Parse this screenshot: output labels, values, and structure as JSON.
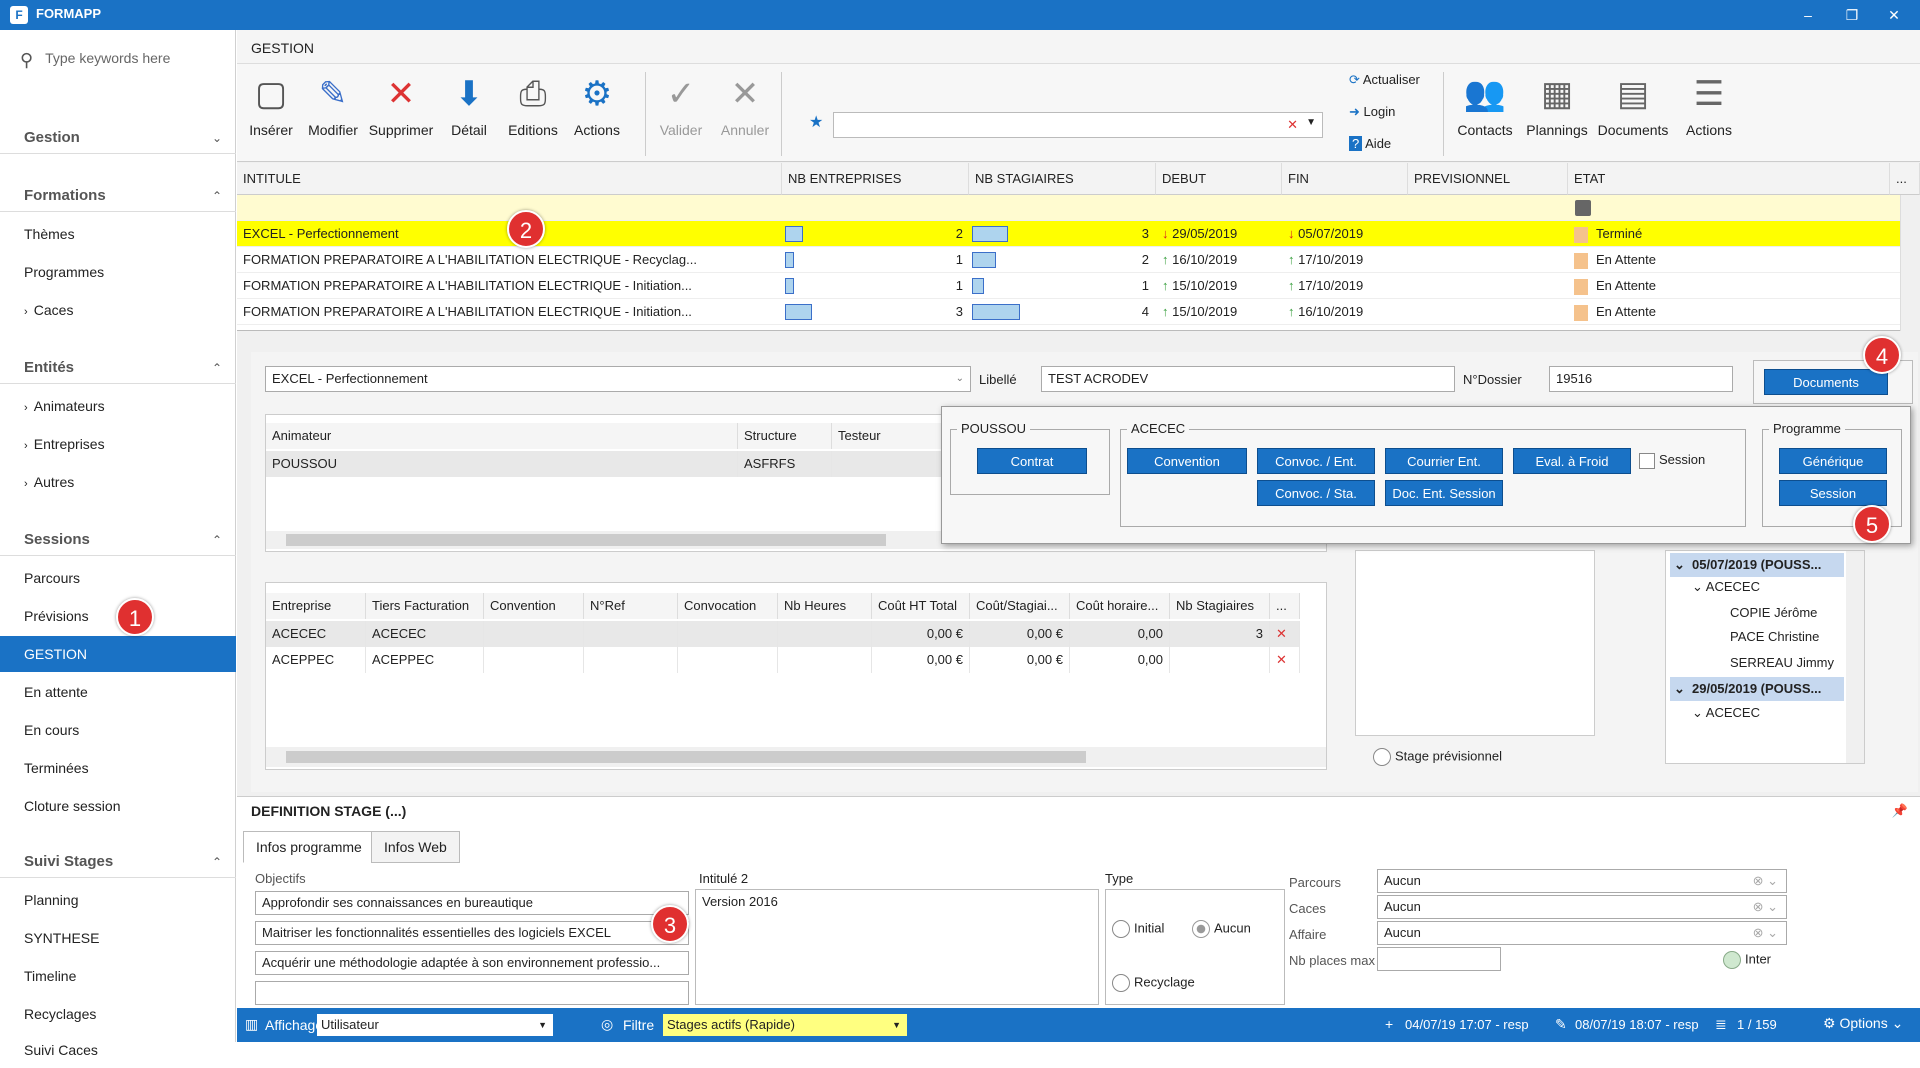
{
  "app": {
    "title": "FORMAPP",
    "win_min": "–",
    "win_restore": "❐",
    "win_close": "✕"
  },
  "sidebar": {
    "search_placeholder": "Type keywords here",
    "groups": [
      {
        "label": "Gestion"
      },
      {
        "label": "Formations"
      },
      {
        "label": "Entités"
      },
      {
        "label": "Sessions"
      },
      {
        "label": "Suivi Stages"
      }
    ],
    "formations": [
      "Thèmes",
      "Programmes",
      "Caces"
    ],
    "entites": [
      "Animateurs",
      "Entreprises",
      "Autres"
    ],
    "sessions": [
      "Parcours",
      "Prévisions",
      "GESTION",
      "En attente",
      "En cours",
      "Terminées",
      "Cloture session"
    ],
    "suivi": [
      "Planning",
      "SYNTHESE",
      "Timeline",
      "Recyclages",
      "Suivi Caces"
    ]
  },
  "ribbon": {
    "title": "GESTION",
    "buttons": [
      "Insérer",
      "Modifier",
      "Supprimer",
      "Détail",
      "Editions",
      "Actions",
      "Valider",
      "Annuler"
    ],
    "small": [
      "Actualiser",
      "Login",
      "Aide"
    ],
    "right": [
      "Contacts",
      "Plannings",
      "Documents",
      "Actions"
    ]
  },
  "grid": {
    "headers": [
      "INTITULE",
      "NB ENTREPRISES",
      "NB STAGIAIRES",
      "DEBUT",
      "FIN",
      "PREVISIONNEL",
      "ETAT"
    ],
    "more": "...",
    "rows": [
      {
        "intitule": "EXCEL - Perfectionnement",
        "ent": "2",
        "stag": "3",
        "debut": "29/05/2019",
        "fin": "05/07/2019",
        "etat": "Terminé",
        "ent_frac": 0.5,
        "stag_frac": 0.75,
        "dir": "down"
      },
      {
        "intitule": "FORMATION PREPARATOIRE A L'HABILITATION ELECTRIQUE - Recyclag...",
        "ent": "1",
        "stag": "2",
        "debut": "16/10/2019",
        "fin": "17/10/2019",
        "etat": "En Attente",
        "ent_frac": 0.25,
        "stag_frac": 0.5,
        "dir": "up"
      },
      {
        "intitule": "FORMATION PREPARATOIRE A L'HABILITATION ELECTRIQUE - Initiation...",
        "ent": "1",
        "stag": "1",
        "debut": "15/10/2019",
        "fin": "17/10/2019",
        "etat": "En Attente",
        "ent_frac": 0.25,
        "stag_frac": 0.25,
        "dir": "up"
      },
      {
        "intitule": "FORMATION PREPARATOIRE A L'HABILITATION ELECTRIQUE - Initiation...",
        "ent": "3",
        "stag": "4",
        "debut": "15/10/2019",
        "fin": "16/10/2019",
        "etat": "En Attente",
        "ent_frac": 0.75,
        "stag_frac": 1.0,
        "dir": "up"
      }
    ]
  },
  "detail": {
    "programme": "EXCEL - Perfectionnement",
    "libelle_label": "Libellé",
    "libelle": "TEST ACRODEV",
    "dossier_label": "N°Dossier",
    "dossier": "19516",
    "documents_btn": "Documents"
  },
  "animateurs": {
    "headers": [
      "Animateur",
      "Structure",
      "Testeur"
    ],
    "rows": [
      [
        "POUSSOU",
        "ASFRFS",
        ""
      ]
    ]
  },
  "entreprises": {
    "headers": [
      "Entreprise",
      "Tiers Facturation",
      "Convention",
      "N°Ref",
      "Convocation",
      "Nb Heures",
      "Coût HT Total",
      "Coût/Stagiai...",
      "Coût horaire...",
      "Nb Stagiaires",
      "..."
    ],
    "rows": [
      [
        "ACECEC",
        "ACECEC",
        "",
        "",
        "",
        "",
        "0,00 €",
        "0,00 €",
        "0,00",
        "3"
      ],
      [
        "ACEPPEC",
        "ACEPPEC",
        "",
        "",
        "",
        "",
        "0,00 €",
        "0,00 €",
        "0,00",
        ""
      ]
    ]
  },
  "docpopup": {
    "g1": "POUSSOU",
    "contrat": "Contrat",
    "g2": "ACECEC",
    "b2": [
      "Convention",
      "Convoc. / Ent.",
      "Courrier Ent.",
      "Eval. à Froid",
      "Convoc. / Sta.",
      "Doc. Ent. Session"
    ],
    "session_chk": "Session",
    "g3": "Programme",
    "generique": "Générique",
    "session": "Session"
  },
  "tree": {
    "items": [
      "05/07/2019 (POUSS...",
      "ACECEC",
      "COPIE Jérôme",
      "PACE Christine",
      "SERREAU Jimmy",
      "29/05/2019 (POUSS...",
      "ACECEC"
    ]
  },
  "stage_previsionnel": "Stage prévisionnel",
  "definition": {
    "title": "DEFINITION STAGE (...)",
    "tabs": [
      "Infos programme",
      "Infos Web"
    ],
    "objectifs_label": "Objectifs",
    "objectifs": [
      "Approfondir ses connaissances en bureautique",
      "Maitriser les fonctionnalités essentielles des logiciels EXCEL",
      "Acquérir une méthodologie adaptée à son environnement professio..."
    ],
    "intitule2_label": "Intitulé 2",
    "intitule2": "Version 2016",
    "type_label": "Type",
    "types": [
      "Initial",
      "Aucun",
      "Recyclage"
    ],
    "parcours_label": "Parcours",
    "parcours": "Aucun",
    "caces_label": "Caces",
    "caces": "Aucun",
    "affaire_label": "Affaire",
    "affaire": "Aucun",
    "places_label": "Nb places max",
    "inter": "Inter"
  },
  "status": {
    "affichage_label": "Affichage",
    "affichage": "Utilisateur",
    "filtre_label": "Filtre",
    "filtre": "Stages actifs (Rapide)",
    "created": "04/07/19 17:07 - resp",
    "modified": "08/07/19 18:07 - resp",
    "pager": "1 / 159",
    "options": "Options"
  },
  "badges": [
    "1",
    "2",
    "3",
    "4",
    "5"
  ]
}
